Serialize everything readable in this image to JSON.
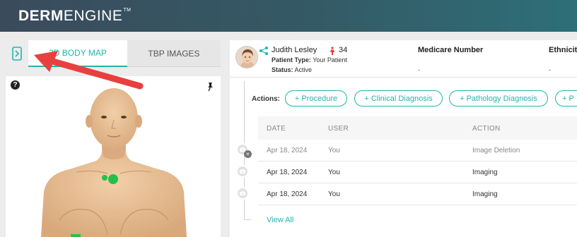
{
  "app": {
    "logo_bold": "DERM",
    "logo_light": "ENGINE",
    "logo_tm": "TM"
  },
  "left_panel": {
    "tabs": [
      {
        "label": "3D BODY MAP",
        "active": true
      },
      {
        "label": "TBP IMAGES",
        "active": false
      }
    ],
    "help_glyph": "?",
    "icons": [
      "sidebar-toggle-icon",
      "help-icon",
      "pin-icon"
    ]
  },
  "patient": {
    "name": "Judith Lesley",
    "age": "34",
    "type_label": "Patient Type:",
    "type_value": "Your Patient",
    "status_label": "Status:",
    "status_value": "Active",
    "medicare_label": "Medicare Number",
    "medicare_value": "-",
    "ethnicity_label": "Ethnicity",
    "ethnicity_value": "-"
  },
  "actions": {
    "label": "Actions:",
    "buttons": [
      "+ Procedure",
      "+ Clinical Diagnosis",
      "+ Pathology Diagnosis",
      "+ P"
    ]
  },
  "history": {
    "columns": [
      "DATE",
      "USER",
      "ACTION"
    ],
    "rows": [
      {
        "date": "Apr 18, 2024",
        "user": "You",
        "action": "Image Deletion"
      },
      {
        "date": "Apr 18, 2024",
        "user": "You",
        "action": "Imaging"
      },
      {
        "date": "Apr 18, 2024",
        "user": "You",
        "action": "Imaging"
      }
    ],
    "view_all": "View All"
  },
  "colors": {
    "accent": "#21b5ad",
    "header_start": "#3a4b5c",
    "header_end": "#2e6f78",
    "annotation_arrow": "#e8403f",
    "lesion_marker": "#22c24a"
  }
}
